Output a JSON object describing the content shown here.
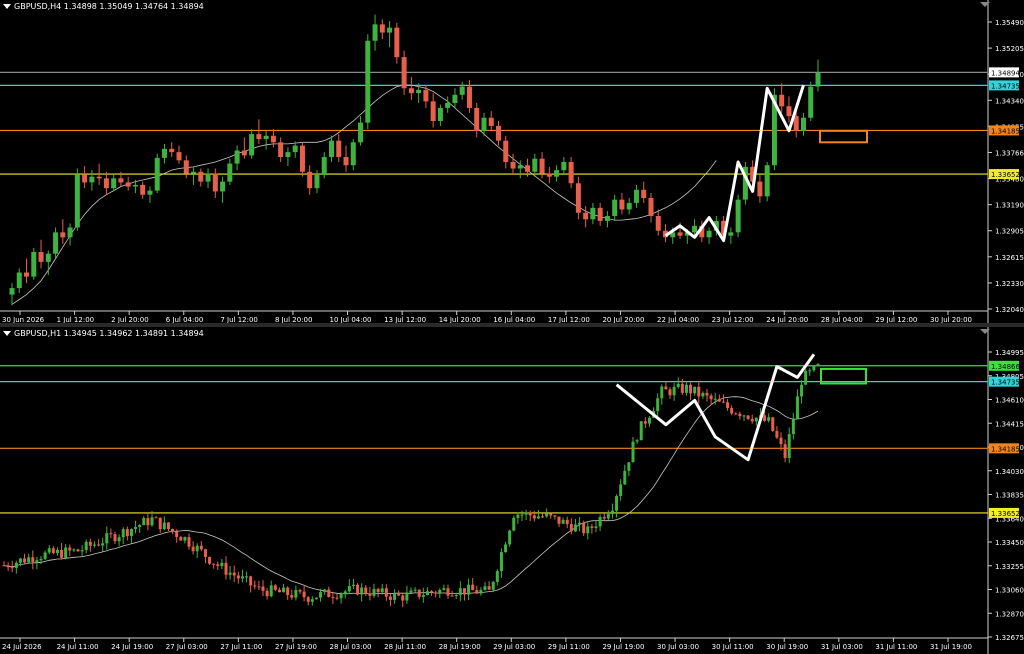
{
  "colors": {
    "background": "#000000",
    "bull": "#3fb33f",
    "bear": "#e8604c",
    "ma": "#c8c8c8",
    "zigzag": "#ffffff",
    "cyan": "#2fd5d8",
    "orange": "#f0851e",
    "yellow": "#f3ec2a",
    "green": "#33e633",
    "gray_line": "#8a8a8a",
    "axis_text": "#ffffff"
  },
  "top": {
    "header": "GBPUSD,H4  1.34898 1.35049 1.34764 1.34894",
    "price_range": [
      1.3198,
      1.3568
    ],
    "price_ticks": [
      "1.35490",
      "1.35205",
      "1.34630",
      "1.34340",
      "1.34055",
      "1.33766",
      "1.33480",
      "1.33190",
      "1.32905",
      "1.32615",
      "1.32330",
      "1.32040"
    ],
    "time_labels": [
      "30 Jun 2026",
      "1 Jul 12:00",
      "2 Jul 20:00",
      "6 Jul 04:00",
      "7 Jul 12:00",
      "8 Jul 20:00",
      "10 Jul 04:00",
      "13 Jul 12:00",
      "14 Jul 20:00",
      "16 Jul 04:00",
      "17 Jul 12:00",
      "20 Jul 20:00",
      "22 Jul 04:00",
      "23 Jul 12:00",
      "24 Jul 20:00",
      "28 Jul 04:00",
      "29 Jul 12:00",
      "30 Jul 20:00"
    ],
    "levels": [
      {
        "price": 1.34894,
        "label": "1.34894",
        "color": "#8a8a8a",
        "label_bg": "#ffffff",
        "label_fg": "#000000"
      },
      {
        "price": 1.34735,
        "label": "1.34735",
        "color": "#2fd5d8",
        "label_bg": "#2fd5d8",
        "label_fg": "#000000"
      },
      {
        "price": 1.34185,
        "label": "1.34185",
        "color": "#f0851e",
        "label_bg": "#f0851e",
        "label_fg": "#000000"
      },
      {
        "price": 1.33652,
        "label": "1.33652",
        "color": "#f3ec2a",
        "label_bg": "#f3ec2a",
        "label_fg": "#000000"
      }
    ],
    "zone": {
      "price_top": 1.3418,
      "price_bottom": 1.3404,
      "color": "#f0851e"
    },
    "candles": [
      [
        1.3218,
        1.3232,
        1.3205,
        1.3226
      ],
      [
        1.3226,
        1.325,
        1.322,
        1.3245
      ],
      [
        1.3245,
        1.3262,
        1.3232,
        1.324
      ],
      [
        1.324,
        1.3275,
        1.3236,
        1.327
      ],
      [
        1.327,
        1.3285,
        1.325,
        1.3258
      ],
      [
        1.3258,
        1.3272,
        1.3242,
        1.3268
      ],
      [
        1.3268,
        1.33,
        1.3262,
        1.3294
      ],
      [
        1.3294,
        1.331,
        1.328,
        1.3288
      ],
      [
        1.3288,
        1.3305,
        1.3278,
        1.33
      ],
      [
        1.33,
        1.3372,
        1.3296,
        1.3365
      ],
      [
        1.3365,
        1.3375,
        1.3348,
        1.3355
      ],
      [
        1.3355,
        1.337,
        1.3345,
        1.3362
      ],
      [
        1.3362,
        1.3378,
        1.3352,
        1.336
      ],
      [
        1.336,
        1.3368,
        1.334,
        1.3348
      ],
      [
        1.3348,
        1.3365,
        1.3344,
        1.336
      ],
      [
        1.336,
        1.3368,
        1.335,
        1.3355
      ],
      [
        1.3355,
        1.3362,
        1.3345,
        1.335
      ],
      [
        1.335,
        1.3358,
        1.3342,
        1.3352
      ],
      [
        1.3352,
        1.3356,
        1.3335,
        1.334
      ],
      [
        1.334,
        1.335,
        1.333,
        1.3345
      ],
      [
        1.3345,
        1.339,
        1.3342,
        1.3385
      ],
      [
        1.3385,
        1.3402,
        1.3378,
        1.3396
      ],
      [
        1.3396,
        1.3404,
        1.3386,
        1.3392
      ],
      [
        1.3392,
        1.34,
        1.3378,
        1.3382
      ],
      [
        1.3382,
        1.3388,
        1.336,
        1.3366
      ],
      [
        1.3366,
        1.3374,
        1.3352,
        1.3368
      ],
      [
        1.3368,
        1.3372,
        1.335,
        1.3356
      ],
      [
        1.3356,
        1.3372,
        1.3348,
        1.3366
      ],
      [
        1.3366,
        1.3372,
        1.3336,
        1.3344
      ],
      [
        1.3344,
        1.3362,
        1.333,
        1.3356
      ],
      [
        1.3356,
        1.3384,
        1.3352,
        1.3378
      ],
      [
        1.3378,
        1.34,
        1.337,
        1.3394
      ],
      [
        1.3394,
        1.341,
        1.3384,
        1.3388
      ],
      [
        1.3388,
        1.342,
        1.3384,
        1.3414
      ],
      [
        1.3414,
        1.3432,
        1.3402,
        1.3408
      ],
      [
        1.3408,
        1.3418,
        1.3395,
        1.3412
      ],
      [
        1.3412,
        1.342,
        1.3398,
        1.3404
      ],
      [
        1.3404,
        1.341,
        1.338,
        1.3386
      ],
      [
        1.3386,
        1.3398,
        1.3375,
        1.3392
      ],
      [
        1.3392,
        1.3405,
        1.3385,
        1.34
      ],
      [
        1.34,
        1.3404,
        1.3362,
        1.3368
      ],
      [
        1.3368,
        1.3376,
        1.334,
        1.3348
      ],
      [
        1.3348,
        1.337,
        1.3342,
        1.3364
      ],
      [
        1.3364,
        1.3392,
        1.336,
        1.3386
      ],
      [
        1.3386,
        1.3412,
        1.338,
        1.3406
      ],
      [
        1.3406,
        1.3414,
        1.338,
        1.3386
      ],
      [
        1.3386,
        1.34,
        1.3368,
        1.3376
      ],
      [
        1.3376,
        1.3408,
        1.337,
        1.3404
      ],
      [
        1.3404,
        1.3436,
        1.34,
        1.3428
      ],
      [
        1.3428,
        1.3536,
        1.342,
        1.3528
      ],
      [
        1.3528,
        1.356,
        1.3516,
        1.3548
      ],
      [
        1.3548,
        1.3554,
        1.353,
        1.3538
      ],
      [
        1.3538,
        1.3552,
        1.352,
        1.3544
      ],
      [
        1.3544,
        1.355,
        1.35,
        1.3508
      ],
      [
        1.3508,
        1.3516,
        1.3462,
        1.347
      ],
      [
        1.347,
        1.3484,
        1.3456,
        1.3464
      ],
      [
        1.3464,
        1.3476,
        1.3452,
        1.3468
      ],
      [
        1.3468,
        1.3474,
        1.3446,
        1.3454
      ],
      [
        1.3454,
        1.3464,
        1.3422,
        1.343
      ],
      [
        1.343,
        1.345,
        1.3424,
        1.3446
      ],
      [
        1.3446,
        1.346,
        1.344,
        1.3452
      ],
      [
        1.3452,
        1.347,
        1.3446,
        1.3462
      ],
      [
        1.3462,
        1.3478,
        1.3456,
        1.3472
      ],
      [
        1.3472,
        1.348,
        1.344,
        1.3446
      ],
      [
        1.3446,
        1.3452,
        1.341,
        1.3418
      ],
      [
        1.3418,
        1.344,
        1.3412,
        1.3434
      ],
      [
        1.3434,
        1.3442,
        1.3418,
        1.3424
      ],
      [
        1.3424,
        1.343,
        1.34,
        1.3406
      ],
      [
        1.3406,
        1.3412,
        1.3372,
        1.338
      ],
      [
        1.338,
        1.339,
        1.3364,
        1.3372
      ],
      [
        1.3372,
        1.3382,
        1.336,
        1.3376
      ],
      [
        1.3376,
        1.3384,
        1.3362,
        1.3368
      ],
      [
        1.3368,
        1.339,
        1.3362,
        1.3384
      ],
      [
        1.3384,
        1.3392,
        1.336,
        1.3366
      ],
      [
        1.3366,
        1.3374,
        1.3354,
        1.3362
      ],
      [
        1.3362,
        1.3376,
        1.3356,
        1.337
      ],
      [
        1.337,
        1.3386,
        1.3364,
        1.338
      ],
      [
        1.338,
        1.3386,
        1.3348,
        1.3354
      ],
      [
        1.3354,
        1.3362,
        1.331,
        1.3318
      ],
      [
        1.3318,
        1.3326,
        1.33,
        1.331
      ],
      [
        1.331,
        1.333,
        1.3304,
        1.3324
      ],
      [
        1.3324,
        1.333,
        1.3302,
        1.3308
      ],
      [
        1.3308,
        1.332,
        1.33,
        1.3314
      ],
      [
        1.3314,
        1.334,
        1.3308,
        1.3334
      ],
      [
        1.3334,
        1.3342,
        1.3316,
        1.3322
      ],
      [
        1.3322,
        1.3336,
        1.3316,
        1.333
      ],
      [
        1.333,
        1.3352,
        1.3324,
        1.3346
      ],
      [
        1.3346,
        1.3356,
        1.333,
        1.3336
      ],
      [
        1.3336,
        1.3342,
        1.3306,
        1.3314
      ],
      [
        1.3314,
        1.3322,
        1.329,
        1.3296
      ],
      [
        1.3296,
        1.3304,
        1.3282,
        1.3288
      ],
      [
        1.3288,
        1.33,
        1.328,
        1.3294
      ],
      [
        1.3294,
        1.3306,
        1.3286,
        1.329
      ],
      [
        1.329,
        1.3298,
        1.328,
        1.3294
      ],
      [
        1.3294,
        1.331,
        1.3288,
        1.3302
      ],
      [
        1.3302,
        1.3308,
        1.3282,
        1.3288
      ],
      [
        1.3288,
        1.33,
        1.328,
        1.3296
      ],
      [
        1.3296,
        1.3314,
        1.329,
        1.3308
      ],
      [
        1.3308,
        1.3314,
        1.3282,
        1.329
      ],
      [
        1.329,
        1.33,
        1.328,
        1.3294
      ],
      [
        1.3294,
        1.334,
        1.3288,
        1.3334
      ],
      [
        1.3334,
        1.338,
        1.3328,
        1.3374
      ],
      [
        1.3374,
        1.3382,
        1.335,
        1.3356
      ],
      [
        1.3356,
        1.3364,
        1.333,
        1.3338
      ],
      [
        1.3338,
        1.338,
        1.3332,
        1.3376
      ],
      [
        1.3376,
        1.347,
        1.337,
        1.3462
      ],
      [
        1.3462,
        1.3476,
        1.344,
        1.3448
      ],
      [
        1.3448,
        1.346,
        1.3428,
        1.3436
      ],
      [
        1.3436,
        1.3444,
        1.341,
        1.3418
      ],
      [
        1.3418,
        1.344,
        1.3412,
        1.3434
      ],
      [
        1.3434,
        1.3478,
        1.343,
        1.3472
      ],
      [
        1.3472,
        1.3505,
        1.3466,
        1.3489
      ]
    ],
    "ma": [
      1.3206,
      1.3212,
      1.3218,
      1.3226,
      1.3235,
      1.3248,
      1.3262,
      1.3276,
      1.329,
      1.3304,
      1.3316,
      1.3326,
      1.3334,
      1.334,
      1.3345,
      1.335,
      1.3353,
      1.3356,
      1.3358,
      1.336,
      1.3362,
      1.3366,
      1.337,
      1.3372,
      1.3373,
      1.3374,
      1.3376,
      1.3378,
      1.338,
      1.3383,
      1.3386,
      1.339,
      1.3393,
      1.3396,
      1.3399,
      1.3401,
      1.3402,
      1.3402,
      1.3402,
      1.3403,
      1.3404,
      1.3404,
      1.3404,
      1.3406,
      1.341,
      1.3416,
      1.3423,
      1.343,
      1.3438,
      1.3446,
      1.3454,
      1.3461,
      1.3467,
      1.3472,
      1.3474,
      1.3474,
      1.3472,
      1.347,
      1.3466,
      1.346,
      1.3454,
      1.3446,
      1.3438,
      1.343,
      1.3422,
      1.3414,
      1.3406,
      1.3398,
      1.3391,
      1.3384,
      1.3377,
      1.337,
      1.3363,
      1.3356,
      1.3349,
      1.3342,
      1.3336,
      1.333,
      1.3325,
      1.332,
      1.3316,
      1.3313,
      1.3311,
      1.3309,
      1.3309,
      1.331,
      1.3311,
      1.3313,
      1.3316,
      1.332,
      1.3324,
      1.3329,
      1.3335,
      1.3342,
      1.335,
      1.336,
      1.337,
      1.3382
    ],
    "ma_start": 0,
    "zigzag": [
      [
        90,
        1.329
      ],
      [
        92,
        1.3302
      ],
      [
        94,
        1.3288
      ],
      [
        96,
        1.3312
      ],
      [
        98,
        1.3284
      ],
      [
        100,
        1.338
      ],
      [
        102,
        1.3344
      ],
      [
        104,
        1.347
      ],
      [
        107,
        1.3418
      ],
      [
        109,
        1.3474
      ]
    ]
  },
  "bottom": {
    "header": "GBPUSD,H1  1.34945 1.34962 1.34891 1.34894",
    "price_range": [
      1.3262,
      1.3512
    ],
    "price_ticks": [
      "1.34995",
      "1.34805",
      "1.34610",
      "1.34415",
      "1.34220",
      "1.34030",
      "1.33835",
      "1.33640",
      "1.33450",
      "1.33255",
      "1.33060",
      "1.32870",
      "1.32675"
    ],
    "time_labels": [
      "24 Jul 2026",
      "24 Jul 11:00",
      "24 Jul 19:00",
      "27 Jul 03:00",
      "27 Jul 11:00",
      "27 Jul 19:00",
      "28 Jul 03:00",
      "28 Jul 11:00",
      "28 Jul 19:00",
      "29 Jul 03:00",
      "29 Jul 11:00",
      "29 Jul 19:00",
      "30 Jul 03:00",
      "30 Jul 11:00",
      "30 Jul 19:00",
      "31 Jul 03:00",
      "31 Jul 11:00",
      "31 Jul 19:00"
    ],
    "levels": [
      {
        "price": 1.34866,
        "label": "1.34866",
        "color": "#33e633",
        "label_bg": "#33e633",
        "label_fg": "#000000"
      },
      {
        "price": 1.34735,
        "label": "1.34735",
        "color": "#2fd5d8",
        "label_bg": "#2fd5d8",
        "label_fg": "#000000"
      },
      {
        "price": 1.34185,
        "label": "1.34185",
        "color": "#f0851e",
        "label_bg": "#f0851e",
        "label_fg": "#000000"
      },
      {
        "price": 1.33652,
        "label": "1.33652",
        "color": "#f3ec2a",
        "label_bg": "#f3ec2a",
        "label_fg": "#000000"
      }
    ],
    "zone": {
      "price_top": 1.3484,
      "price_bottom": 1.3472,
      "color": "#33e633"
    },
    "candle_count": 199,
    "zigzag": [
      [
        149,
        1.3471
      ],
      [
        161,
        1.3438
      ],
      [
        168,
        1.3458
      ],
      [
        173,
        1.3428
      ],
      [
        181,
        1.3409
      ],
      [
        188,
        1.3486
      ],
      [
        193,
        1.3477
      ],
      [
        197,
        1.3496
      ]
    ]
  }
}
